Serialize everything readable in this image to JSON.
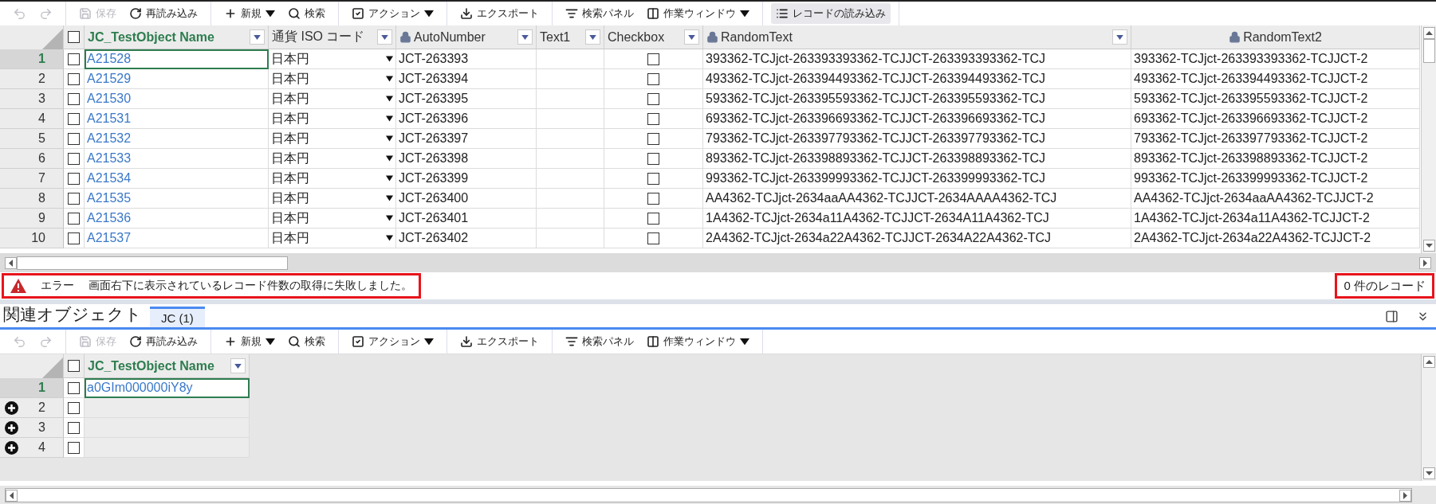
{
  "toolbar": {
    "groups": [
      [
        {
          "kind": "icon",
          "disabled": true
        },
        {
          "kind": "icon",
          "disabled": true
        }
      ],
      [
        {
          "kind": "button",
          "label": "保存",
          "disabled": true,
          "dropdown": false
        },
        {
          "kind": "button",
          "label": "再読み込み",
          "disabled": false,
          "dropdown": false
        }
      ],
      [
        {
          "kind": "button",
          "label": "新規",
          "disabled": false,
          "dropdown": true
        },
        {
          "kind": "button",
          "label": "検索",
          "disabled": false,
          "dropdown": false
        }
      ],
      [
        {
          "kind": "button",
          "label": "アクション",
          "disabled": false,
          "dropdown": true
        }
      ],
      [
        {
          "kind": "button",
          "label": "エクスポート",
          "disabled": false,
          "dropdown": false
        }
      ],
      [
        {
          "kind": "button",
          "label": "検索パネル",
          "disabled": false,
          "dropdown": false
        },
        {
          "kind": "button",
          "label": "作業ウィンドウ",
          "disabled": false,
          "dropdown": true
        }
      ],
      [
        {
          "kind": "button",
          "label": "レコードの読み込み",
          "disabled": false,
          "dropdown": false,
          "highlighted": true
        }
      ]
    ]
  },
  "grid": {
    "all_checked": false,
    "columns": [
      {
        "label": "JC_TestObject Name",
        "kind": "link",
        "primary": true,
        "locked": false,
        "filter": true
      },
      {
        "label": "通貨 ISO コード",
        "kind": "picklist",
        "primary": false,
        "locked": false,
        "filter": true
      },
      {
        "label": "AutoNumber",
        "kind": "text",
        "primary": false,
        "locked": true,
        "filter": true
      },
      {
        "label": "Text1",
        "kind": "text",
        "primary": false,
        "locked": false,
        "filter": true
      },
      {
        "label": "Checkbox",
        "kind": "checkbox",
        "primary": false,
        "locked": false,
        "filter": true
      },
      {
        "label": "RandomText",
        "kind": "text",
        "primary": false,
        "locked": true,
        "filter": true
      },
      {
        "label": "RandomText2",
        "kind": "text",
        "primary": false,
        "locked": true,
        "filter": false
      }
    ],
    "rows": [
      {
        "number": "1",
        "selected": true,
        "checked": false,
        "cells": [
          "A21528",
          "日本円",
          "JCT-263393",
          null,
          false,
          "393362-TCJjct-263393393362-TCJJCT-263393393362-TCJ",
          "393362-TCJjct-263393393362-TCJJCT-2"
        ]
      },
      {
        "number": "2",
        "selected": false,
        "checked": false,
        "cells": [
          "A21529",
          "日本円",
          "JCT-263394",
          null,
          false,
          "493362-TCJjct-263394493362-TCJJCT-263394493362-TCJ",
          "493362-TCJjct-263394493362-TCJJCT-2"
        ]
      },
      {
        "number": "3",
        "selected": false,
        "checked": false,
        "cells": [
          "A21530",
          "日本円",
          "JCT-263395",
          null,
          false,
          "593362-TCJjct-263395593362-TCJJCT-263395593362-TCJ",
          "593362-TCJjct-263395593362-TCJJCT-2"
        ]
      },
      {
        "number": "4",
        "selected": false,
        "checked": false,
        "cells": [
          "A21531",
          "日本円",
          "JCT-263396",
          null,
          false,
          "693362-TCJjct-263396693362-TCJJCT-263396693362-TCJ",
          "693362-TCJjct-263396693362-TCJJCT-2"
        ]
      },
      {
        "number": "5",
        "selected": false,
        "checked": false,
        "cells": [
          "A21532",
          "日本円",
          "JCT-263397",
          null,
          false,
          "793362-TCJjct-263397793362-TCJJCT-263397793362-TCJ",
          "793362-TCJjct-263397793362-TCJJCT-2"
        ]
      },
      {
        "number": "6",
        "selected": false,
        "checked": false,
        "cells": [
          "A21533",
          "日本円",
          "JCT-263398",
          null,
          false,
          "893362-TCJjct-263398893362-TCJJCT-263398893362-TCJ",
          "893362-TCJjct-263398893362-TCJJCT-2"
        ]
      },
      {
        "number": "7",
        "selected": false,
        "checked": false,
        "cells": [
          "A21534",
          "日本円",
          "JCT-263399",
          null,
          false,
          "993362-TCJjct-263399993362-TCJJCT-263399993362-TCJ",
          "993362-TCJjct-263399993362-TCJJCT-2"
        ]
      },
      {
        "number": "8",
        "selected": false,
        "checked": false,
        "cells": [
          "A21535",
          "日本円",
          "JCT-263400",
          null,
          false,
          "AA4362-TCJjct-2634aaAA4362-TCJJCT-2634AAAA4362-TCJ",
          "AA4362-TCJjct-2634aaAA4362-TCJJCT-2"
        ]
      },
      {
        "number": "9",
        "selected": false,
        "checked": false,
        "cells": [
          "A21536",
          "日本円",
          "JCT-263401",
          null,
          false,
          "1A4362-TCJjct-2634a11A4362-TCJJCT-2634A11A4362-TCJ",
          "1A4362-TCJjct-2634a11A4362-TCJJCT-2"
        ]
      },
      {
        "number": "10",
        "selected": false,
        "checked": false,
        "cells": [
          "A21537",
          "日本円",
          "JCT-263402",
          null,
          false,
          "2A4362-TCJjct-2634a22A4362-TCJJCT-2634A22A4362-TCJ",
          "2A4362-TCJjct-2634a22A4362-TCJJCT-2"
        ]
      }
    ]
  },
  "status_bar": {
    "kind": "error",
    "level_label": "エラー",
    "message": "画面右下に表示されているレコード件数の取得に失敗しました。",
    "record_count": "0 件のレコード",
    "highlighted": true
  },
  "related": {
    "title": "関連オブジェクト",
    "tabs": [
      {
        "label": "JC (1)",
        "selected": true
      }
    ],
    "toolbar": {
      "groups": [
        [
          {
            "kind": "icon",
            "disabled": true
          },
          {
            "kind": "icon",
            "disabled": true
          }
        ],
        [
          {
            "kind": "button",
            "label": "保存",
            "disabled": true,
            "dropdown": false
          },
          {
            "kind": "button",
            "label": "再読み込み",
            "disabled": false,
            "dropdown": false
          }
        ],
        [
          {
            "kind": "button",
            "label": "新規",
            "disabled": false,
            "dropdown": true
          },
          {
            "kind": "button",
            "label": "検索",
            "disabled": false,
            "dropdown": false
          }
        ],
        [
          {
            "kind": "button",
            "label": "アクション",
            "disabled": false,
            "dropdown": true
          }
        ],
        [
          {
            "kind": "button",
            "label": "エクスポート",
            "disabled": false,
            "dropdown": false
          }
        ],
        [
          {
            "kind": "button",
            "label": "検索パネル",
            "disabled": false,
            "dropdown": false
          },
          {
            "kind": "button",
            "label": "作業ウィンドウ",
            "disabled": false,
            "dropdown": true
          }
        ]
      ]
    },
    "grid": {
      "all_checked": false,
      "columns": [
        {
          "label": "JC_TestObject Name",
          "kind": "link",
          "primary": true,
          "locked": false,
          "filter": true
        }
      ],
      "rows": [
        {
          "number": "1",
          "kind": "record",
          "selected": true,
          "checked": false,
          "cells": [
            "a0GIm000000iY8y"
          ]
        },
        {
          "number": "2",
          "kind": "new",
          "selected": false,
          "checked": false,
          "cells": [
            null
          ]
        },
        {
          "number": "3",
          "kind": "new",
          "selected": false,
          "checked": false,
          "cells": [
            null
          ]
        },
        {
          "number": "4",
          "kind": "new",
          "selected": false,
          "checked": false,
          "cells": [
            null
          ]
        }
      ]
    }
  }
}
